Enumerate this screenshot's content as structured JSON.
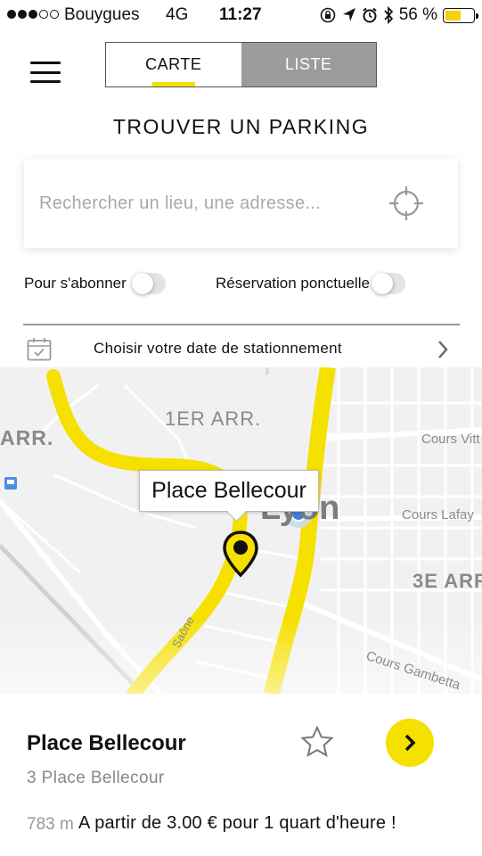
{
  "status_bar": {
    "carrier": "Bouygues",
    "network": "4G",
    "time": "11:27",
    "battery_percent": "56 %",
    "battery_level": 0.56,
    "signal_bars": 3,
    "signal_total": 5,
    "icons": [
      "rotation-lock-icon",
      "location-arrow-icon",
      "alarm-icon",
      "bluetooth-icon"
    ],
    "battery_color": "#f5d20a"
  },
  "header": {
    "tabs": [
      {
        "label": "CARTE",
        "active": true
      },
      {
        "label": "LISTE",
        "active": false
      }
    ],
    "accent_color": "#f5e000"
  },
  "page_title": "TROUVER UN PARKING",
  "search": {
    "placeholder": "Rechercher un lieu, une adresse...",
    "value": ""
  },
  "filters": {
    "subscribe_label": "Pour s'abonner",
    "subscribe_on": false,
    "one_time_label": "Réservation ponctuelle",
    "one_time_on": false
  },
  "date_row": {
    "label": "Choisir votre date de stationnement"
  },
  "map": {
    "labels": {
      "arr1": "1ER ARR.",
      "arr2_partial": "ARR.",
      "arr3": "3E ARR",
      "cours_vitton": "Cours Vitt",
      "cours_lafayette": "Cours Lafay",
      "cours_gambetta": "Cours Gambetta",
      "saone": "Saône",
      "lyon_partial": "Lyon"
    },
    "tooltip": "Place Bellecour",
    "road_color": "#f5e000"
  },
  "result": {
    "name": "Place Bellecour",
    "address": "3 Place Bellecour",
    "distance": "783 m",
    "price_text": "A partir de 3.00 € pour 1 quart d'heure !"
  }
}
